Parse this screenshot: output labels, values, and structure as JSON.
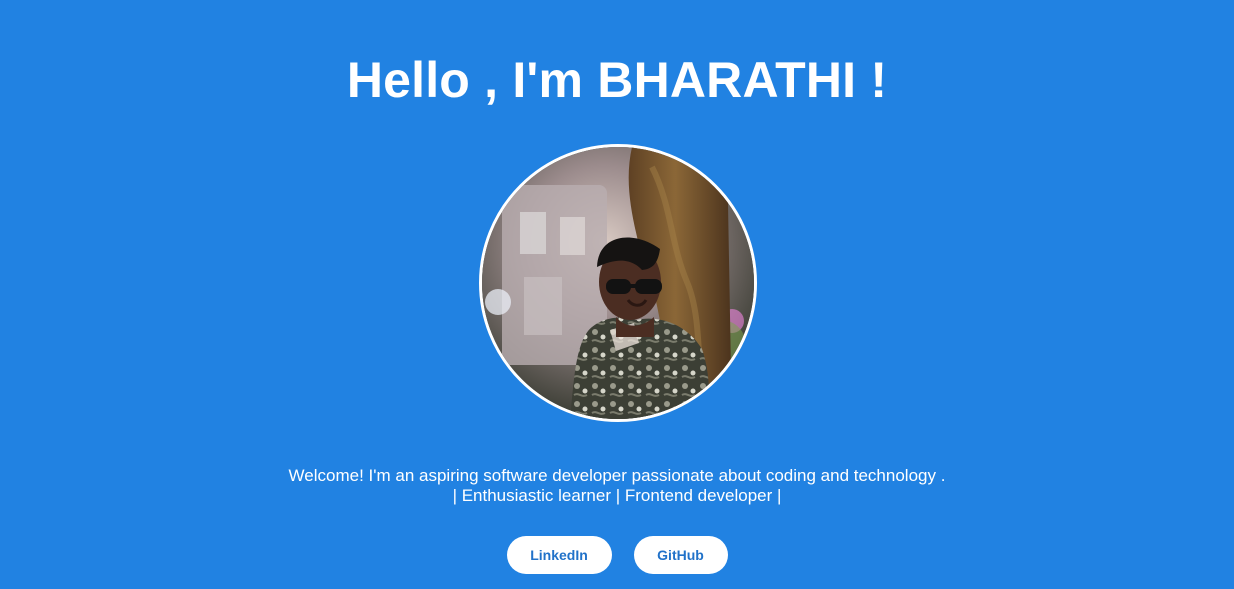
{
  "header": {
    "title": "Hello , I'm BHARATHI !"
  },
  "profile": {
    "photo_name": "profile-photo"
  },
  "intro": {
    "line1": "Welcome! I'm an aspiring software developer passionate about coding and technology .",
    "line2": "| Enthusiastic learner | Frontend developer |"
  },
  "links": {
    "linkedin_label": "LinkedIn",
    "github_label": "GitHub"
  },
  "colors": {
    "background": "#2182e2",
    "button_background": "#ffffff",
    "button_text": "#2172c9"
  }
}
